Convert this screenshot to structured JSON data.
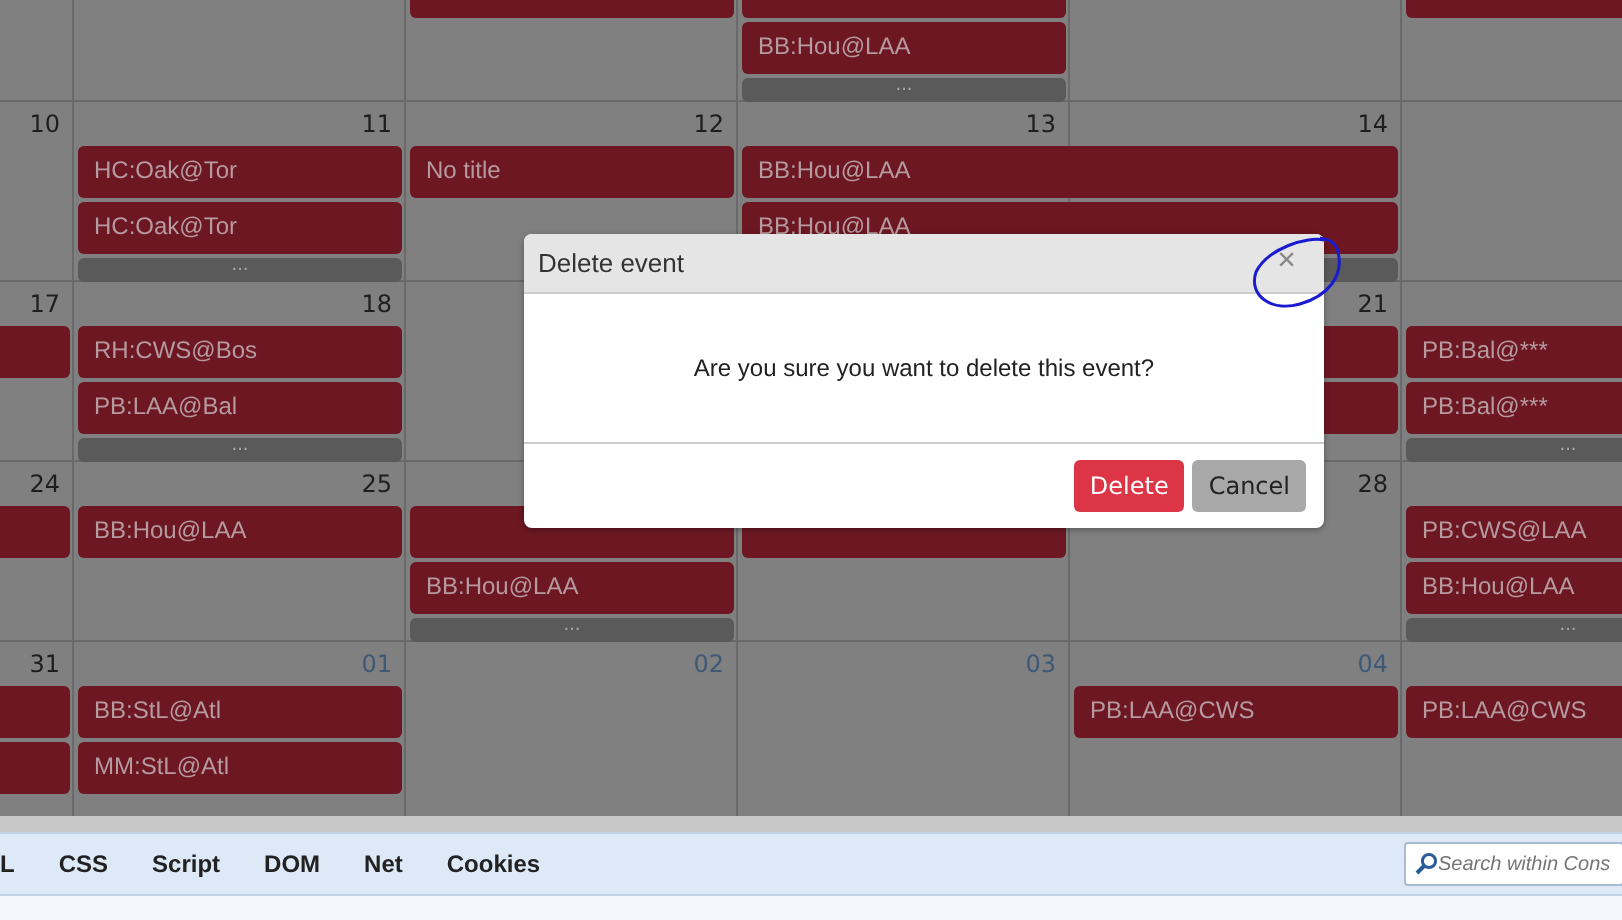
{
  "calendar": {
    "weeks": [
      {
        "column_3": {
          "slots": [
            {
              "kind": "event"
            }
          ]
        },
        "column_4": {
          "slots": [
            {
              "kind": "event"
            },
            {
              "kind": "event",
              "title": "BB:Hou@LAA"
            },
            {
              "kind": "more",
              "label": "..."
            }
          ]
        },
        "column_6": {
          "slots": [
            {
              "kind": "event"
            }
          ]
        }
      },
      {
        "column_1": {
          "number": "10",
          "other_month": false
        },
        "column_2": {
          "number": "11",
          "other_month": false,
          "slots": [
            {
              "kind": "event",
              "title": "HC:Oak@Tor"
            },
            {
              "kind": "event",
              "title": "HC:Oak@Tor"
            },
            {
              "kind": "more",
              "label": "..."
            }
          ]
        },
        "column_3": {
          "number": "12",
          "other_month": false,
          "slots": [
            {
              "kind": "event",
              "title": "No title"
            }
          ]
        },
        "column_4": {
          "number": "13",
          "other_month": false,
          "slots": [
            {
              "kind": "event",
              "title": "BB:Hou@LAA"
            },
            {
              "kind": "event",
              "title": "BB:Hou@LAA"
            }
          ]
        },
        "column_5": {
          "number": "14",
          "other_month": false,
          "slots": [
            {
              "kind": "continued"
            },
            {
              "kind": "continued"
            },
            {
              "kind": "more"
            }
          ]
        }
      },
      {
        "column_1": {
          "number": "17",
          "other_month": false,
          "slots": [
            {
              "kind": "event"
            }
          ]
        },
        "column_2": {
          "number": "18",
          "other_month": false,
          "slots": [
            {
              "kind": "event",
              "title": "RH:CWS@Bos"
            },
            {
              "kind": "event",
              "title": "PB:LAA@Bal"
            },
            {
              "kind": "more",
              "label": "..."
            }
          ]
        },
        "column_5": {
          "number": "21",
          "other_month": false,
          "slots": [
            {
              "kind": "event"
            },
            {
              "kind": "event"
            }
          ]
        },
        "column_6": {
          "slots": [
            {
              "kind": "event",
              "title": "PB:Bal@***"
            },
            {
              "kind": "event",
              "title": "PB:Bal@***"
            },
            {
              "kind": "more",
              "label": "..."
            }
          ]
        }
      },
      {
        "column_1": {
          "number": "24",
          "other_month": false,
          "slots": [
            {
              "kind": "event"
            }
          ]
        },
        "column_2": {
          "number": "25",
          "other_month": false,
          "slots": [
            {
              "kind": "event",
              "title": "BB:Hou@LAA"
            }
          ]
        },
        "column_3": {
          "slots": [
            {
              "kind": "event"
            },
            {
              "kind": "event",
              "title": "BB:Hou@LAA"
            },
            {
              "kind": "more",
              "label": "..."
            }
          ]
        },
        "column_4": {
          "slots": [
            {
              "kind": "event"
            }
          ]
        },
        "column_5": {
          "number": "28",
          "other_month": false
        },
        "column_6": {
          "slots": [
            {
              "kind": "event",
              "title": "PB:CWS@LAA"
            },
            {
              "kind": "event",
              "title": "BB:Hou@LAA"
            },
            {
              "kind": "more",
              "label": "..."
            }
          ]
        }
      },
      {
        "column_1": {
          "number": "31",
          "other_month": false,
          "slots": [
            {
              "kind": "event"
            },
            {
              "kind": "event"
            }
          ]
        },
        "column_2": {
          "number": "01",
          "other_month": true,
          "slots": [
            {
              "kind": "event",
              "title": "BB:StL@Atl"
            },
            {
              "kind": "event",
              "title": "MM:StL@Atl"
            }
          ]
        },
        "column_3": {
          "number": "02",
          "other_month": true
        },
        "column_4": {
          "number": "03",
          "other_month": true
        },
        "column_5": {
          "number": "04",
          "other_month": true,
          "slots": [
            {
              "kind": "event",
              "title": "PB:LAA@CWS"
            }
          ]
        },
        "column_6": {
          "slots": [
            {
              "kind": "event",
              "title": "PB:LAA@CWS"
            }
          ]
        }
      }
    ]
  },
  "dialog": {
    "title": "Delete event",
    "close": "×",
    "message": "Are you sure you want to delete this event?",
    "buttons": [
      {
        "label": "Delete",
        "kind": "danger"
      },
      {
        "label": "Cancel",
        "kind": "secondary"
      }
    ]
  },
  "devtools": {
    "tabs": [
      "L",
      "CSS",
      "Script",
      "DOM",
      "Net",
      "Cookies"
    ],
    "search": {
      "placeholder": "Search within Cons"
    }
  }
}
